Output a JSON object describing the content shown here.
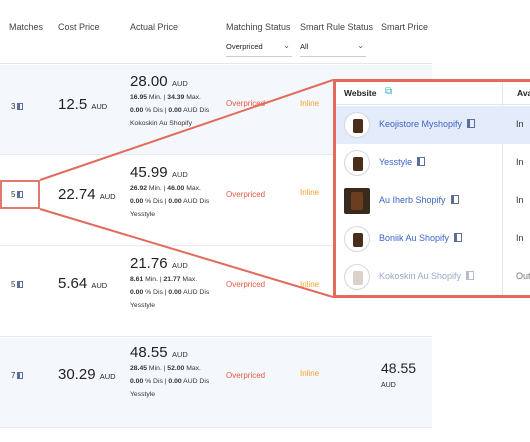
{
  "headers": {
    "matches": "Matches",
    "cost_price": "Cost Price",
    "actual_price": "Actual Price",
    "matching_status": "Matching Status",
    "smart_rule_status": "Smart Rule Status",
    "smart_price": "Smart Price"
  },
  "filters": {
    "matching_status": "Overpriced",
    "smart_rule_status": "All"
  },
  "rows": [
    {
      "matches": "3",
      "cost": "12.5",
      "cost_unit": "AUD",
      "actual": "28.00",
      "actual_unit": "AUD",
      "minmax_a": "16.95",
      "minmax_b": "Min. | ",
      "minmax_c": "34.39",
      "minmax_d": " Max.",
      "dis_a": "0.00",
      "dis_b": " % Dis | ",
      "dis_c": "0.00",
      "dis_d": " AUD Dis",
      "store": "Kokoskin Au Shopify",
      "status": "Overpriced",
      "rule": "Inline",
      "smart": "",
      "smart_unit": ""
    },
    {
      "matches": "5",
      "cost": "22.74",
      "cost_unit": "AUD",
      "actual": "45.99",
      "actual_unit": "AUD",
      "minmax_a": "26.92",
      "minmax_b": " Min. | ",
      "minmax_c": "46.00",
      "minmax_d": " Max.",
      "dis_a": "0.00",
      "dis_b": " % Dis | ",
      "dis_c": "0.00",
      "dis_d": " AUD Dis",
      "store": "Yesstyle",
      "status": "Overpriced",
      "rule": "Inline",
      "smart": "",
      "smart_unit": ""
    },
    {
      "matches": "5",
      "cost": "5.64",
      "cost_unit": "AUD",
      "actual": "21.76",
      "actual_unit": "AUD",
      "minmax_a": "8.61",
      "minmax_b": " Min. | ",
      "minmax_c": "21.77",
      "minmax_d": " Max.",
      "dis_a": "0.00",
      "dis_b": " % Dis | ",
      "dis_c": "0.00",
      "dis_d": " AUD Dis",
      "store": "Yesstyle",
      "status": "Overpriced",
      "rule": "Inline",
      "smart": "",
      "smart_unit": ""
    },
    {
      "matches": "7",
      "cost": "30.29",
      "cost_unit": "AUD",
      "actual": "48.55",
      "actual_unit": "AUD",
      "minmax_a": "28.45",
      "minmax_b": " Min. | ",
      "minmax_c": "52.00",
      "minmax_d": " Max.",
      "dis_a": "0.00",
      "dis_b": " % Dis | ",
      "dis_c": "0.00",
      "dis_d": " AUD Dis",
      "store": "Yesstyle",
      "status": "Overpriced",
      "rule": "Inline",
      "smart": "48.55",
      "smart_unit": "AUD"
    }
  ],
  "popup": {
    "website_header": "Website",
    "avail_header": "Ava",
    "items": [
      {
        "name": "Keojistore Myshopify",
        "avail": "In"
      },
      {
        "name": "Yesstyle",
        "avail": "In"
      },
      {
        "name": "Au Iherb Shopify",
        "avail": "In"
      },
      {
        "name": "Boniik Au Shopify",
        "avail": "In"
      },
      {
        "name": "Kokoskin Au Shopify",
        "avail": "Out"
      }
    ]
  },
  "colors": {
    "overpriced": "#e85a42",
    "inline": "#f1a12a",
    "link": "#3a64c8",
    "highlight": "#e36a5c"
  },
  "icons": {
    "matches": "compare-icon",
    "external": "external-link-icon",
    "dropdown": "chevron-down-icon"
  }
}
